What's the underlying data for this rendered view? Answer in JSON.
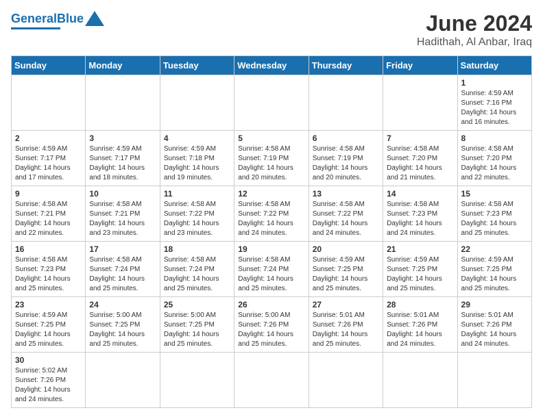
{
  "header": {
    "logo_general": "General",
    "logo_blue": "Blue",
    "title": "June 2024",
    "subtitle": "Hadithah, Al Anbar, Iraq"
  },
  "weekdays": [
    "Sunday",
    "Monday",
    "Tuesday",
    "Wednesday",
    "Thursday",
    "Friday",
    "Saturday"
  ],
  "weeks": [
    [
      {
        "day": "",
        "info": ""
      },
      {
        "day": "",
        "info": ""
      },
      {
        "day": "",
        "info": ""
      },
      {
        "day": "",
        "info": ""
      },
      {
        "day": "",
        "info": ""
      },
      {
        "day": "",
        "info": ""
      },
      {
        "day": "1",
        "info": "Sunrise: 4:59 AM\nSunset: 7:16 PM\nDaylight: 14 hours\nand 16 minutes."
      }
    ],
    [
      {
        "day": "2",
        "info": "Sunrise: 4:59 AM\nSunset: 7:17 PM\nDaylight: 14 hours\nand 17 minutes."
      },
      {
        "day": "3",
        "info": "Sunrise: 4:59 AM\nSunset: 7:17 PM\nDaylight: 14 hours\nand 18 minutes."
      },
      {
        "day": "4",
        "info": "Sunrise: 4:59 AM\nSunset: 7:18 PM\nDaylight: 14 hours\nand 19 minutes."
      },
      {
        "day": "5",
        "info": "Sunrise: 4:58 AM\nSunset: 7:19 PM\nDaylight: 14 hours\nand 20 minutes."
      },
      {
        "day": "6",
        "info": "Sunrise: 4:58 AM\nSunset: 7:19 PM\nDaylight: 14 hours\nand 20 minutes."
      },
      {
        "day": "7",
        "info": "Sunrise: 4:58 AM\nSunset: 7:20 PM\nDaylight: 14 hours\nand 21 minutes."
      },
      {
        "day": "8",
        "info": "Sunrise: 4:58 AM\nSunset: 7:20 PM\nDaylight: 14 hours\nand 22 minutes."
      }
    ],
    [
      {
        "day": "9",
        "info": "Sunrise: 4:58 AM\nSunset: 7:21 PM\nDaylight: 14 hours\nand 22 minutes."
      },
      {
        "day": "10",
        "info": "Sunrise: 4:58 AM\nSunset: 7:21 PM\nDaylight: 14 hours\nand 23 minutes."
      },
      {
        "day": "11",
        "info": "Sunrise: 4:58 AM\nSunset: 7:22 PM\nDaylight: 14 hours\nand 23 minutes."
      },
      {
        "day": "12",
        "info": "Sunrise: 4:58 AM\nSunset: 7:22 PM\nDaylight: 14 hours\nand 24 minutes."
      },
      {
        "day": "13",
        "info": "Sunrise: 4:58 AM\nSunset: 7:22 PM\nDaylight: 14 hours\nand 24 minutes."
      },
      {
        "day": "14",
        "info": "Sunrise: 4:58 AM\nSunset: 7:23 PM\nDaylight: 14 hours\nand 24 minutes."
      },
      {
        "day": "15",
        "info": "Sunrise: 4:58 AM\nSunset: 7:23 PM\nDaylight: 14 hours\nand 25 minutes."
      }
    ],
    [
      {
        "day": "16",
        "info": "Sunrise: 4:58 AM\nSunset: 7:23 PM\nDaylight: 14 hours\nand 25 minutes."
      },
      {
        "day": "17",
        "info": "Sunrise: 4:58 AM\nSunset: 7:24 PM\nDaylight: 14 hours\nand 25 minutes."
      },
      {
        "day": "18",
        "info": "Sunrise: 4:58 AM\nSunset: 7:24 PM\nDaylight: 14 hours\nand 25 minutes."
      },
      {
        "day": "19",
        "info": "Sunrise: 4:58 AM\nSunset: 7:24 PM\nDaylight: 14 hours\nand 25 minutes."
      },
      {
        "day": "20",
        "info": "Sunrise: 4:59 AM\nSunset: 7:25 PM\nDaylight: 14 hours\nand 25 minutes."
      },
      {
        "day": "21",
        "info": "Sunrise: 4:59 AM\nSunset: 7:25 PM\nDaylight: 14 hours\nand 25 minutes."
      },
      {
        "day": "22",
        "info": "Sunrise: 4:59 AM\nSunset: 7:25 PM\nDaylight: 14 hours\nand 25 minutes."
      }
    ],
    [
      {
        "day": "23",
        "info": "Sunrise: 4:59 AM\nSunset: 7:25 PM\nDaylight: 14 hours\nand 25 minutes."
      },
      {
        "day": "24",
        "info": "Sunrise: 5:00 AM\nSunset: 7:25 PM\nDaylight: 14 hours\nand 25 minutes."
      },
      {
        "day": "25",
        "info": "Sunrise: 5:00 AM\nSunset: 7:25 PM\nDaylight: 14 hours\nand 25 minutes."
      },
      {
        "day": "26",
        "info": "Sunrise: 5:00 AM\nSunset: 7:26 PM\nDaylight: 14 hours\nand 25 minutes."
      },
      {
        "day": "27",
        "info": "Sunrise: 5:01 AM\nSunset: 7:26 PM\nDaylight: 14 hours\nand 25 minutes."
      },
      {
        "day": "28",
        "info": "Sunrise: 5:01 AM\nSunset: 7:26 PM\nDaylight: 14 hours\nand 24 minutes."
      },
      {
        "day": "29",
        "info": "Sunrise: 5:01 AM\nSunset: 7:26 PM\nDaylight: 14 hours\nand 24 minutes."
      }
    ],
    [
      {
        "day": "30",
        "info": "Sunrise: 5:02 AM\nSunset: 7:26 PM\nDaylight: 14 hours\nand 24 minutes."
      },
      {
        "day": "",
        "info": ""
      },
      {
        "day": "",
        "info": ""
      },
      {
        "day": "",
        "info": ""
      },
      {
        "day": "",
        "info": ""
      },
      {
        "day": "",
        "info": ""
      },
      {
        "day": "",
        "info": ""
      }
    ]
  ]
}
